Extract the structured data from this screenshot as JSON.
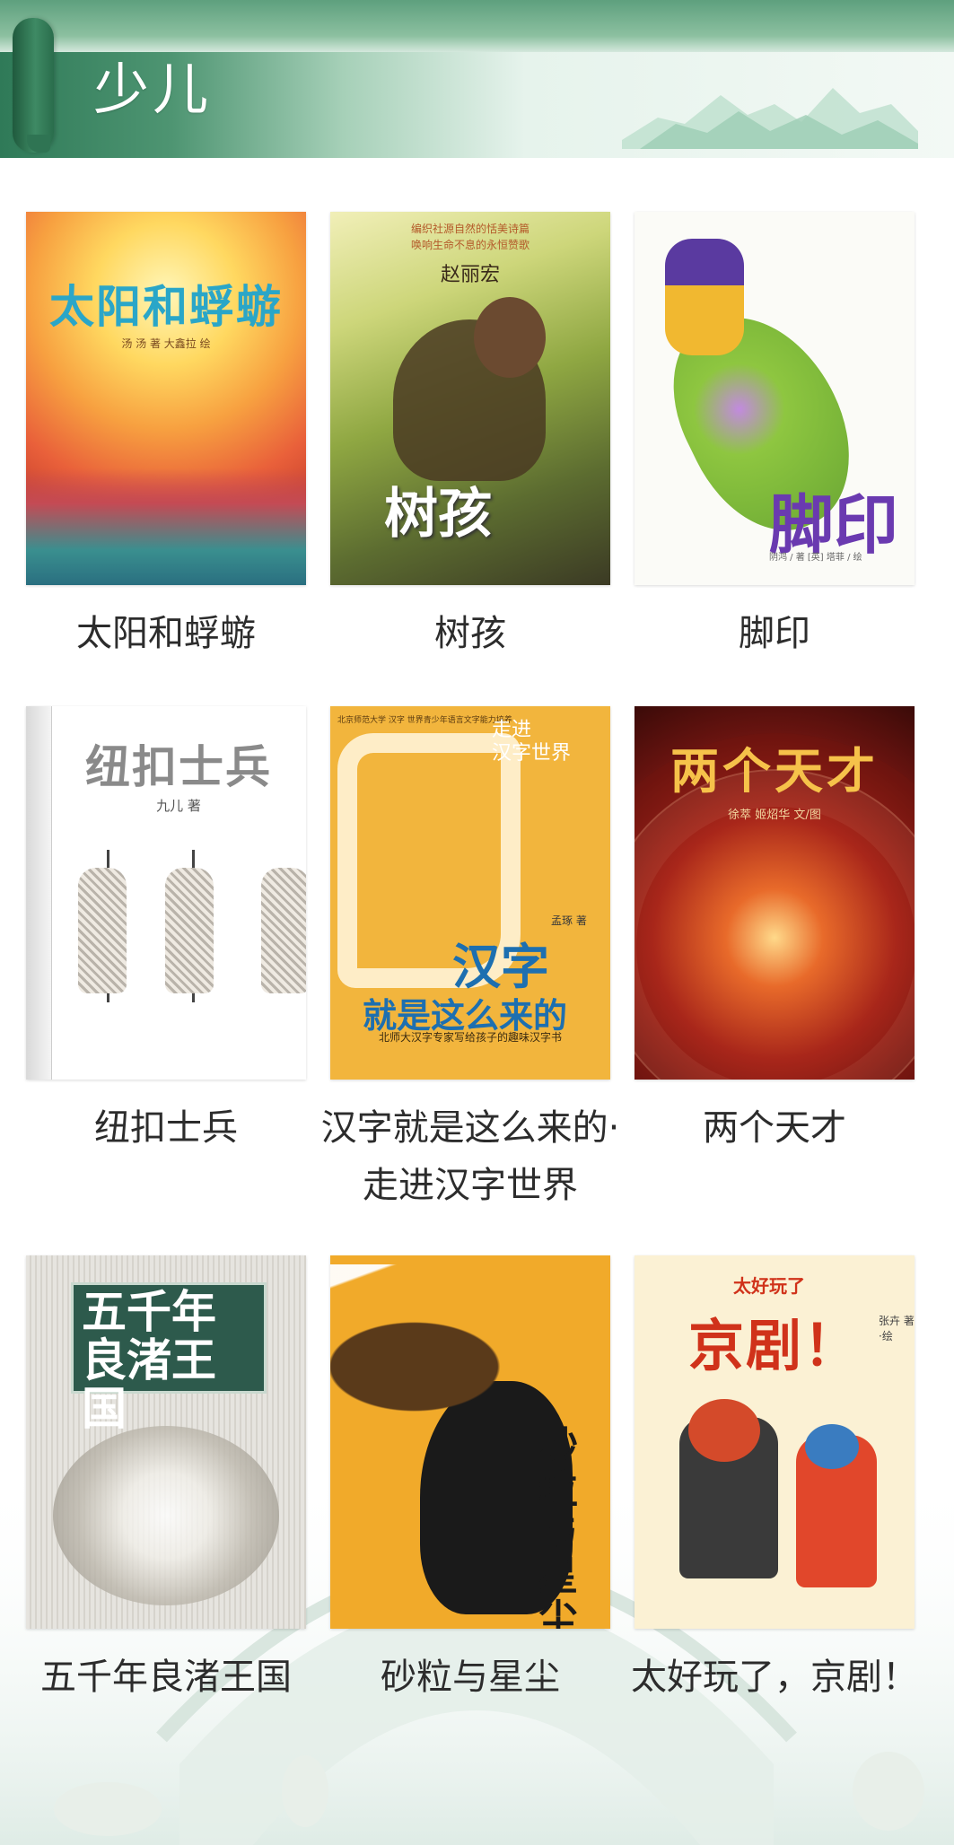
{
  "header": {
    "title": "少儿"
  },
  "books": [
    {
      "label": "太阳和蜉蝣",
      "cover": {
        "title": "太阳和蜉蝣",
        "credit": "汤 汤 著    大鑫拉 绘"
      }
    },
    {
      "label": "树孩",
      "cover": {
        "title": "树孩",
        "author": "赵丽宏",
        "tagline": "编织社源自然的恬美诗篇\n唤响生命不息的永恒赞歌"
      }
    },
    {
      "label": "脚印",
      "cover": {
        "title": "脚印",
        "credit": "阴鸿 / 著  [英] 塔菲 / 绘"
      }
    },
    {
      "label": "纽扣士兵",
      "cover": {
        "title": "纽扣士兵",
        "author": "九儿 著"
      }
    },
    {
      "label": "汉字就是这么来的·走进汉字世界",
      "cover": {
        "title_line1": "汉字",
        "title_line2": "就是这么来的",
        "series": "走进\n汉字世界",
        "author": "孟琢 著",
        "subtitle": "北师大汉字专家写给孩子的趣味汉字书",
        "top_note": "北京师范大学 汉字 世界青少年语言文字能力培养"
      }
    },
    {
      "label": "两个天才",
      "cover": {
        "title": "两个天才",
        "credit": "徐萃  姬炤华  文/图"
      }
    },
    {
      "label": "五千年良渚王国",
      "cover": {
        "title": "五千年良渚王国"
      }
    },
    {
      "label": "砂粒与星尘",
      "cover": {
        "title": "砂粒与星尘"
      }
    },
    {
      "label": "太好玩了，京剧！",
      "cover": {
        "title_small": "太好玩了",
        "title": "京剧！",
        "credit": "张卉 著·绘"
      }
    }
  ]
}
